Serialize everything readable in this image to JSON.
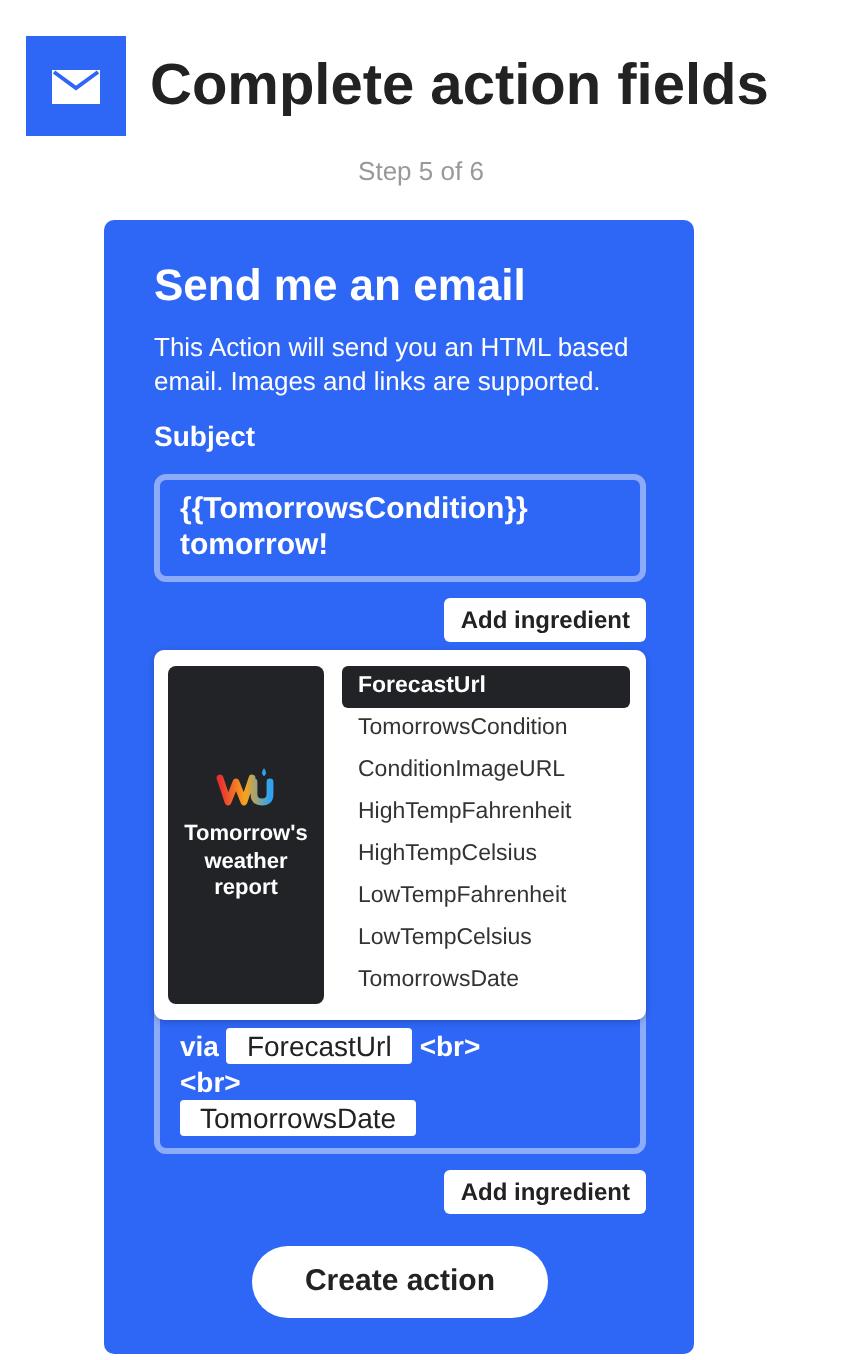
{
  "header": {
    "title": "Complete action fields",
    "step": "Step 5 of 6"
  },
  "card": {
    "title": "Send me an email",
    "description": "This Action will send you an HTML based email. Images and links are supported.",
    "subject": {
      "label": "Subject",
      "lines": [
        "{{TomorrowsCondition}}",
        "tomorrow!"
      ]
    },
    "add_ingredient_top": "Add ingredient",
    "ingredient_menu": {
      "service": "Tomorrow's weather report",
      "items": [
        {
          "label": "ForecastUrl",
          "selected": true
        },
        {
          "label": "TomorrowsCondition",
          "selected": false
        },
        {
          "label": "ConditionImageURL",
          "selected": false
        },
        {
          "label": "HighTempFahrenheit",
          "selected": false
        },
        {
          "label": "HighTempCelsius",
          "selected": false
        },
        {
          "label": "LowTempFahrenheit",
          "selected": false
        },
        {
          "label": "LowTempCelsius",
          "selected": false
        },
        {
          "label": "TomorrowsDate",
          "selected": false
        }
      ]
    },
    "body_lines": [
      [
        {
          "kind": "text",
          "text": "via"
        },
        {
          "kind": "ingredient",
          "text": "ForecastUrl"
        },
        {
          "kind": "text",
          "text": "<br>"
        }
      ],
      [
        {
          "kind": "text",
          "text": "<br>"
        }
      ],
      [
        {
          "kind": "ingredient",
          "text": "TomorrowsDate"
        }
      ]
    ],
    "add_ingredient_bottom": "Add ingredient",
    "create_button": "Create action"
  }
}
